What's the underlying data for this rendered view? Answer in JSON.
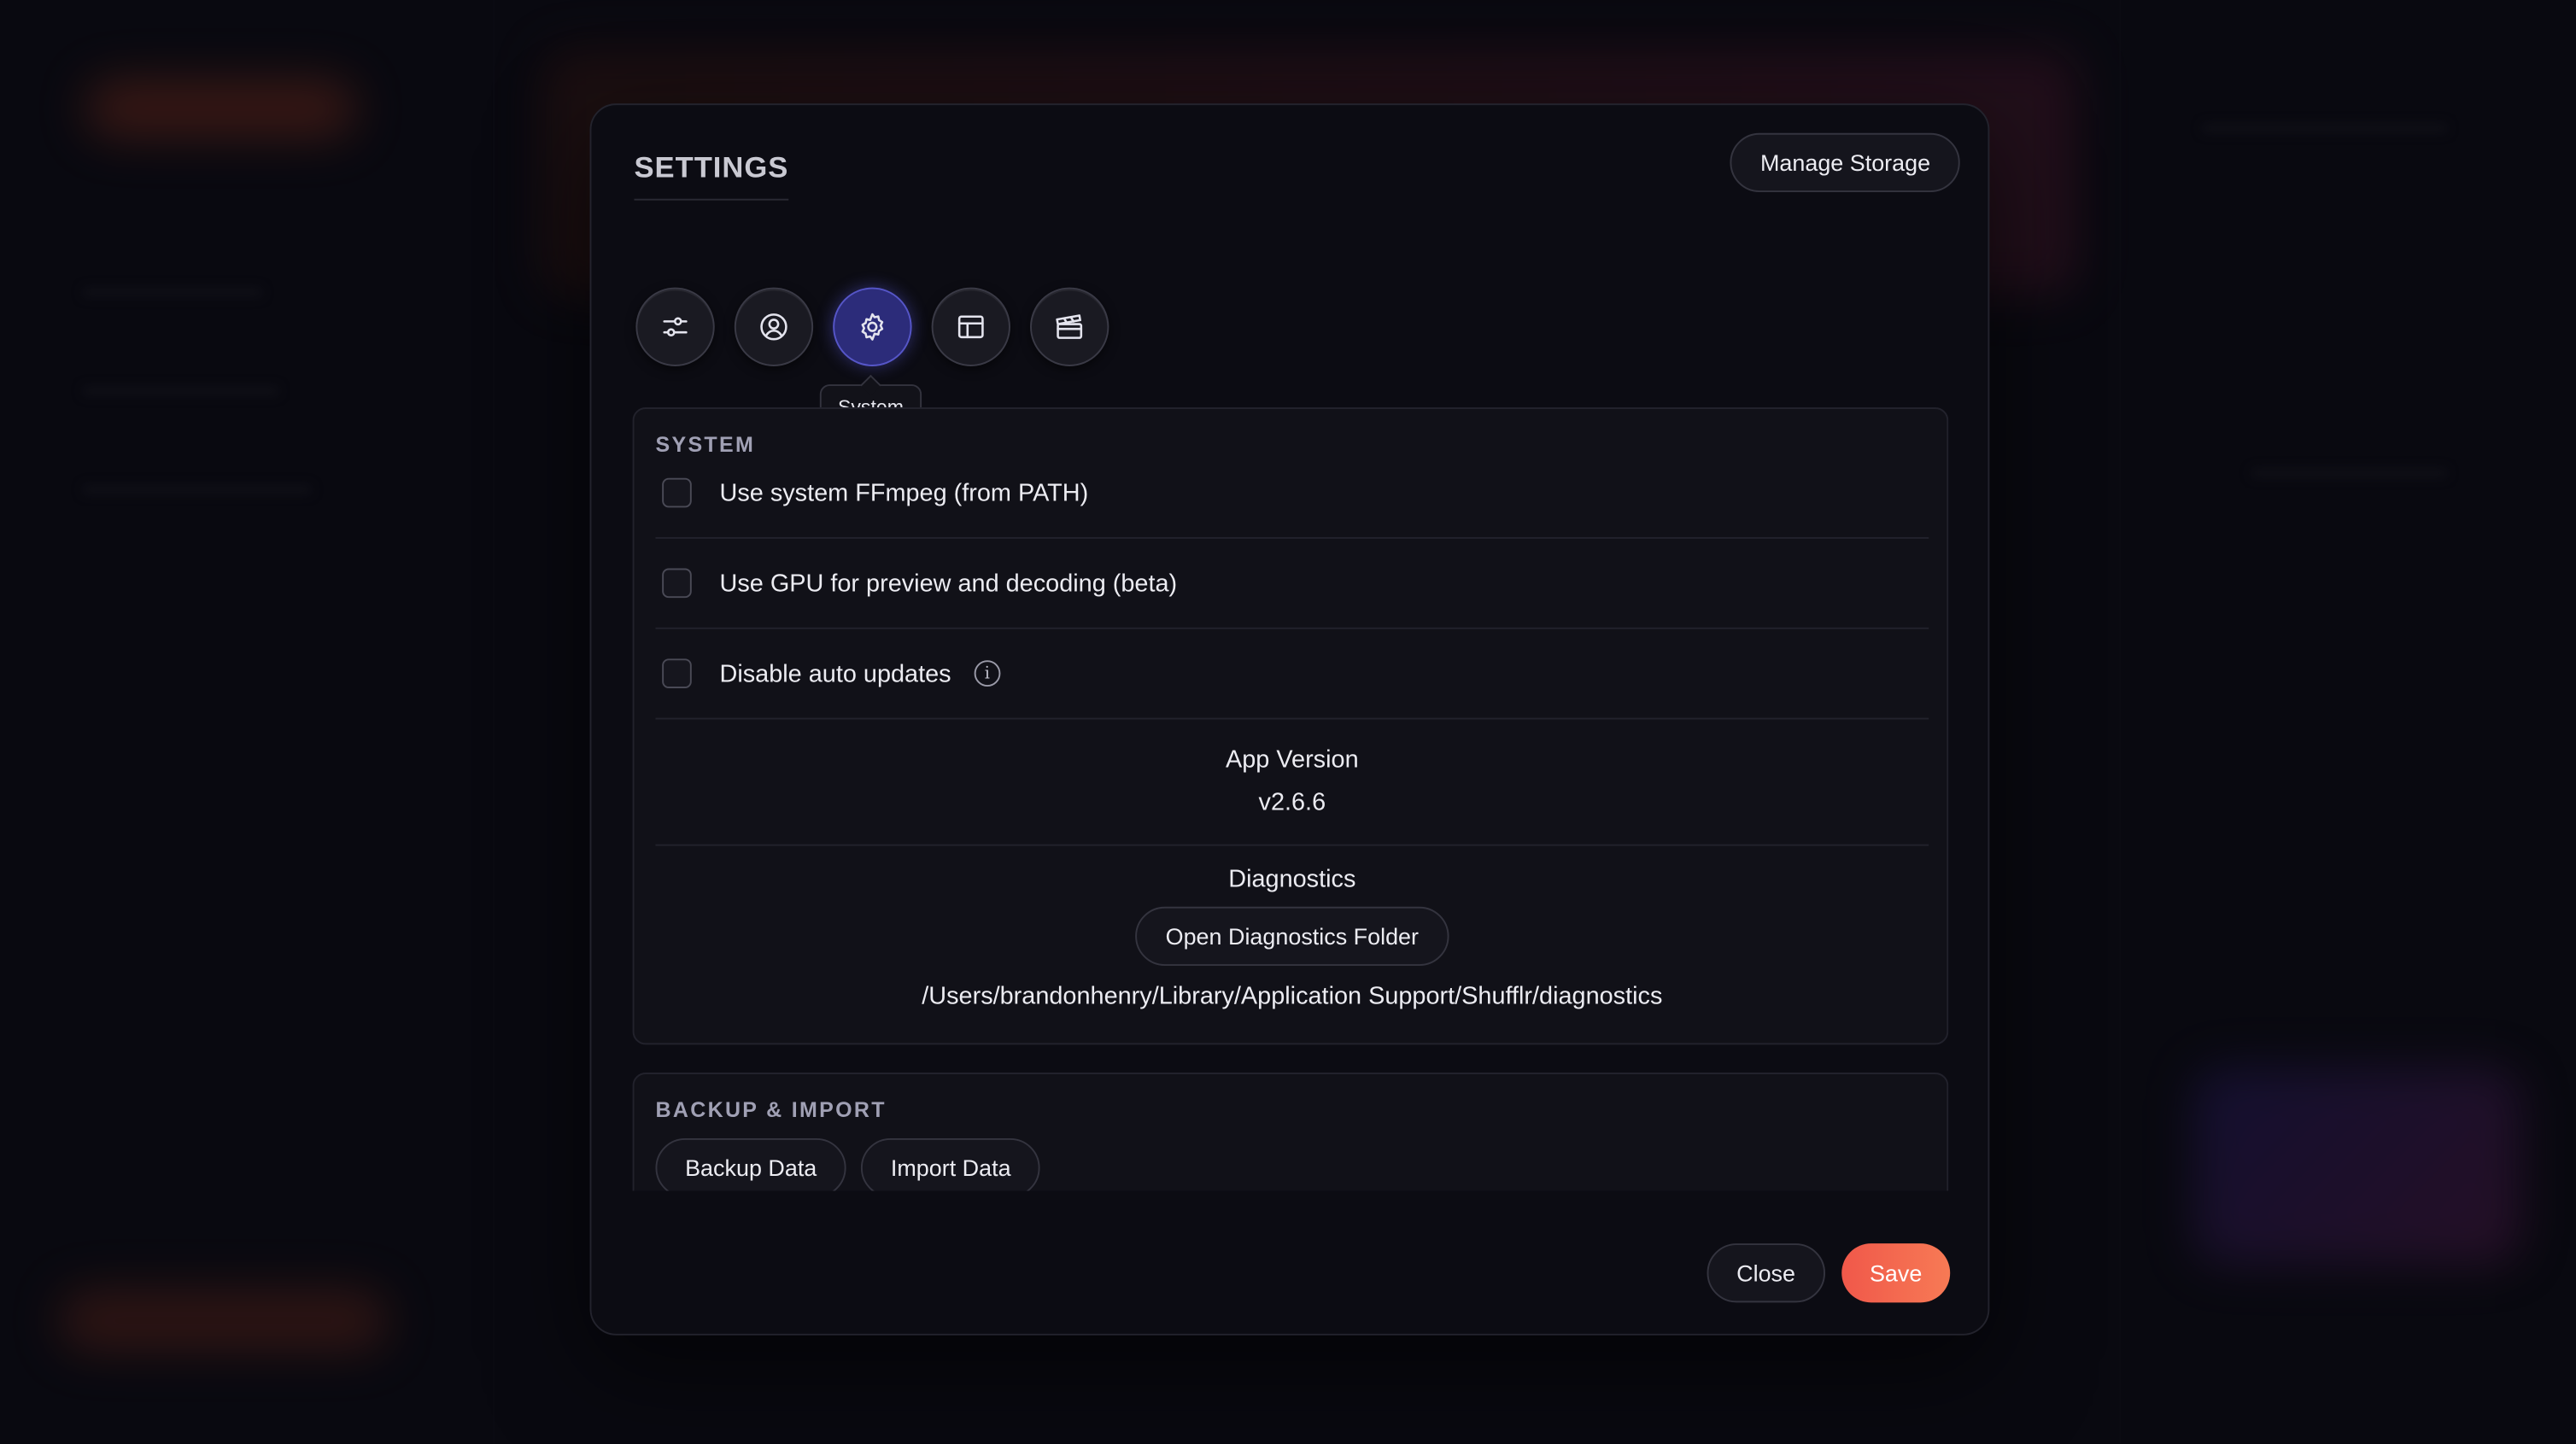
{
  "dialog": {
    "title": "SETTINGS",
    "manage_storage_label": "Manage Storage"
  },
  "tabs": [
    {
      "icon": "sliders-icon",
      "tooltip": ""
    },
    {
      "icon": "user-circle-icon",
      "tooltip": ""
    },
    {
      "icon": "gear-icon",
      "tooltip": "System",
      "active": true
    },
    {
      "icon": "layout-icon",
      "tooltip": ""
    },
    {
      "icon": "clapperboard-icon",
      "tooltip": ""
    }
  ],
  "active_tab_tooltip": "System",
  "system": {
    "title": "SYSTEM",
    "options": [
      {
        "label": "Use system FFmpeg (from PATH)",
        "checked": false
      },
      {
        "label": "Use GPU for preview and decoding (beta)",
        "checked": false
      },
      {
        "label": "Disable auto updates",
        "checked": false,
        "info_icon": "i"
      }
    ],
    "app_version_label": "App Version",
    "app_version_value": "v2.6.6",
    "diagnostics_label": "Diagnostics",
    "open_diagnostics_button": "Open Diagnostics Folder",
    "diagnostics_path": "/Users/brandonhenry/Library/Application Support/Shufflr/diagnostics"
  },
  "backup": {
    "title": "BACKUP & IMPORT",
    "backup_button": "Backup Data",
    "import_button": "Import Data"
  },
  "footer": {
    "close_label": "Close",
    "save_label": "Save"
  },
  "colors": {
    "accent_save": "#f26a4e",
    "active_tab": "#2c2c7a"
  }
}
